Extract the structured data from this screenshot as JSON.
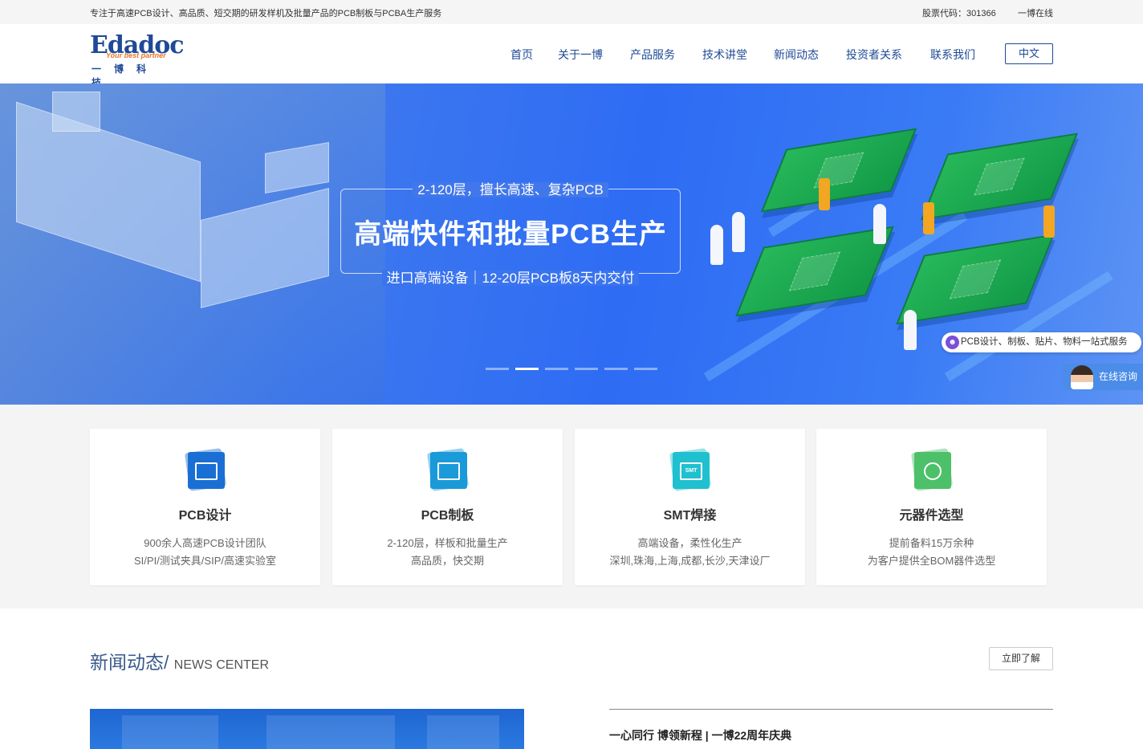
{
  "topbar": {
    "slogan": "专注于高速PCB设计、高品质、短交期的研发样机及批量产品的PCB制板与PCBA生产服务",
    "stock_code": "股票代码：301366",
    "online": "一博在线"
  },
  "logo": {
    "brand": "Edadoc",
    "tagline": "Your best partner",
    "cn": "一博科技"
  },
  "nav": {
    "items": [
      {
        "label": "首页"
      },
      {
        "label": "关于一博"
      },
      {
        "label": "产品服务"
      },
      {
        "label": "技术讲堂"
      },
      {
        "label": "新闻动态"
      },
      {
        "label": "投资者关系"
      },
      {
        "label": "联系我们"
      }
    ],
    "language": "中文"
  },
  "hero": {
    "subtitle_top": "2-120层，擅长高速、复杂PCB",
    "title": "高端快件和批量PCB生产",
    "subtitle_bottom": "进口高端设备｜12-20层PCB板8天内交付",
    "active_slide": 2,
    "slide_count": 6
  },
  "float": {
    "service": "PCB设计、制板、贴片、物料一站式服务",
    "service_icon": "chat-icon",
    "consult": "在线咨询"
  },
  "services": [
    {
      "title": "PCB设计",
      "line1": "900余人高速PCB设计团队",
      "line2": "SI/PI/测试夹具/SIP/高速实验室",
      "color": "#1a6fd4",
      "icon": "monitor-circuit-icon"
    },
    {
      "title": "PCB制板",
      "line1": "2-120层，样板和批量生产",
      "line2": "高品质，快交期",
      "color": "#1a9ad8",
      "icon": "circuit-board-icon"
    },
    {
      "title": "SMT焊接",
      "line1": "高端设备，柔性化生产",
      "line2": "深圳,珠海,上海,成都,长沙,天津设厂",
      "color": "#1fc0cf",
      "icon": "smt-chip-icon",
      "icon_text": "SMT"
    },
    {
      "title": "元器件选型",
      "line1": "提前备料15万余种",
      "line2": "为客户提供全BOM器件选型",
      "color": "#4dc06a",
      "icon": "component-reel-icon"
    }
  ],
  "news": {
    "title": "新闻动态/",
    "title_en": "NEWS CENTER",
    "more": "立即了解",
    "headline": "一心同行 博领新程 | 一博22周年庆典"
  }
}
